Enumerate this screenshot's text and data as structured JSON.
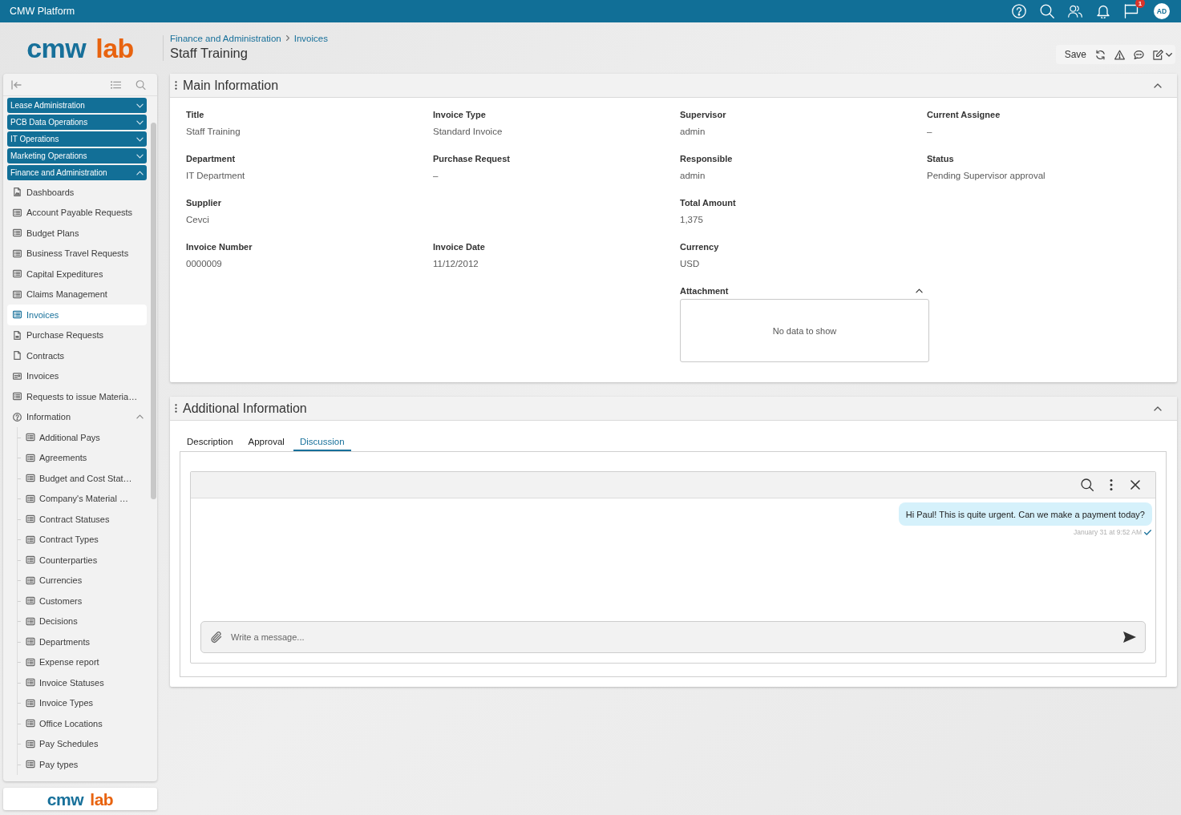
{
  "top_bar": {
    "title": "CMW Platform",
    "notification_count": "1",
    "avatar": "AD"
  },
  "header": {
    "logo": [
      "cmw",
      "lab"
    ],
    "breadcrumbs": [
      "Finance and Administration",
      "Invoices"
    ],
    "title": "Staff Training",
    "toolbar": {
      "save": "Save"
    }
  },
  "sidebar": {
    "groups": [
      {
        "label": "Lease Administration",
        "expanded": false
      },
      {
        "label": "PCB Data Operations",
        "expanded": false
      },
      {
        "label": "IT Operations",
        "expanded": false
      },
      {
        "label": "Marketing Operations",
        "expanded": false
      },
      {
        "label": "Finance and Administration",
        "expanded": true,
        "children": [
          {
            "label": "Dashboards",
            "kind": "dashboard",
            "selected": false
          },
          {
            "label": "Account Payable Requests",
            "kind": "list",
            "selected": false
          },
          {
            "label": "Budget Plans",
            "kind": "list",
            "selected": false
          },
          {
            "label": "Business Travel Requests",
            "kind": "list",
            "selected": false
          },
          {
            "label": "Capital Expeditures",
            "kind": "list",
            "selected": false
          },
          {
            "label": "Claims Management",
            "kind": "list",
            "selected": false
          },
          {
            "label": "Invoices",
            "kind": "list",
            "selected": true
          },
          {
            "label": "Purchase Requests",
            "kind": "form",
            "selected": false
          },
          {
            "label": "Contracts",
            "kind": "document",
            "selected": false
          },
          {
            "label": "Invoices",
            "kind": "card",
            "selected": false
          },
          {
            "label": "Requests to issue Materia…",
            "kind": "list",
            "selected": false
          },
          {
            "label": "Information",
            "kind": "folder",
            "selected": false,
            "expanded": true,
            "children": [
              {
                "label": "Additional Pays",
                "kind": "list",
                "selected": false
              },
              {
                "label": "Agreements",
                "kind": "list",
                "selected": false
              },
              {
                "label": "Budget and Cost Stat…",
                "kind": "list",
                "selected": false
              },
              {
                "label": "Company's Material …",
                "kind": "list",
                "selected": false
              },
              {
                "label": "Contract Statuses",
                "kind": "list",
                "selected": false
              },
              {
                "label": "Contract Types",
                "kind": "list",
                "selected": false
              },
              {
                "label": "Counterparties",
                "kind": "list",
                "selected": false
              },
              {
                "label": "Currencies",
                "kind": "list",
                "selected": false
              },
              {
                "label": "Customers",
                "kind": "list",
                "selected": false
              },
              {
                "label": "Decisions",
                "kind": "list",
                "selected": false
              },
              {
                "label": "Departments",
                "kind": "list",
                "selected": false
              },
              {
                "label": "Expense report",
                "kind": "list",
                "selected": false
              },
              {
                "label": "Invoice Statuses",
                "kind": "list",
                "selected": false
              },
              {
                "label": "Invoice Types",
                "kind": "list",
                "selected": false
              },
              {
                "label": "Office Locations",
                "kind": "list",
                "selected": false
              },
              {
                "label": "Pay Schedules",
                "kind": "list",
                "selected": false
              },
              {
                "label": "Pay types",
                "kind": "list",
                "selected": false
              }
            ]
          }
        ]
      }
    ],
    "footer_logo": [
      "cmw",
      "lab"
    ]
  },
  "main_information": {
    "title": "Main Information",
    "expanded": true,
    "rows": [
      [
        {
          "label": "Title",
          "value": "Staff Training"
        },
        {
          "label": "Invoice Type",
          "value": "Standard Invoice"
        },
        {
          "label": "Supervisor",
          "value": "admin"
        },
        {
          "label": "Current Assignee",
          "value": "–"
        }
      ],
      [
        {
          "label": "Department",
          "value": "IT Department"
        },
        {
          "label": "Purchase Request",
          "value": "–"
        },
        {
          "label": "Responsible",
          "value": "admin"
        },
        {
          "label": "Status",
          "value": "Pending Supervisor approval"
        }
      ],
      [
        {
          "label": "Supplier",
          "value": "Cevci"
        },
        null,
        {
          "label": "Total Amount",
          "value": "1,375"
        },
        null
      ],
      [
        {
          "label": "Invoice Number",
          "value": "0000009"
        },
        {
          "label": "Invoice Date",
          "value": "11/12/2012"
        },
        {
          "label": "Currency",
          "value": "USD"
        },
        null
      ]
    ],
    "attachment": {
      "label": "Attachment",
      "expanded": true,
      "empty_text": "No data to show"
    }
  },
  "additional_information": {
    "title": "Additional Information",
    "expanded": true,
    "tabs": [
      {
        "label": "Description",
        "selected": false
      },
      {
        "label": "Approval",
        "selected": false
      },
      {
        "label": "Discussion",
        "selected": true
      }
    ],
    "discussion": {
      "messages": [
        {
          "text": "Hi Paul! This is quite urgent. Can we make a payment today?",
          "time": "January 31 at 9:52 AM",
          "read": true
        }
      ],
      "input": {
        "placeholder": "Write a message..."
      }
    }
  }
}
